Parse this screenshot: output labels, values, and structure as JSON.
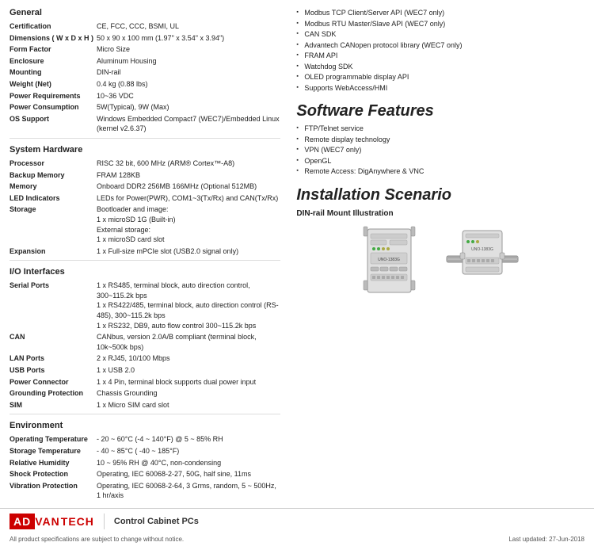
{
  "general": {
    "title": "General",
    "specs": [
      {
        "label": "Certification",
        "value": "CE, FCC, CCC, BSMI, UL"
      },
      {
        "label": "Dimensions ( W x D x H )",
        "value": "50 x 90 x 100 mm (1.97\" x 3.54\" x 3.94\")"
      },
      {
        "label": "Form Factor",
        "value": "Micro Size"
      },
      {
        "label": "Enclosure",
        "value": "Aluminum Housing"
      },
      {
        "label": "Mounting",
        "value": "DIN-rail"
      },
      {
        "label": "Weight (Net)",
        "value": "0.4 kg (0.88 lbs)"
      },
      {
        "label": "Power Requirements",
        "value": "10~36 VDC"
      },
      {
        "label": "Power Consumption",
        "value": "5W(Typical), 9W (Max)"
      },
      {
        "label": "OS Support",
        "value": "Windows Embedded Compact7 (WEC7)/Embedded Linux (kernel v2.6.37)"
      }
    ]
  },
  "system_hardware": {
    "title": "System Hardware",
    "specs": [
      {
        "label": "Processor",
        "value": "RISC 32 bit, 600 MHz (ARM® Cortex™-A8)"
      },
      {
        "label": "Backup Memory",
        "value": "FRAM 128KB"
      },
      {
        "label": "Memory",
        "value": "Onboard DDR2 256MB 166MHz (Optional 512MB)"
      },
      {
        "label": "LED Indicators",
        "value": "LEDs for Power(PWR), COM1~3(Tx/Rx) and CAN(Tx/Rx)"
      },
      {
        "label": "Storage",
        "value": "Bootloader and image:\n1 x microSD 1G (Built-in)\nExternal storage:\n1 x microSD card slot"
      },
      {
        "label": "Expansion",
        "value": "1 x Full-size mPCIe slot (USB2.0 signal only)"
      }
    ]
  },
  "io_interfaces": {
    "title": "I/O Interfaces",
    "specs": [
      {
        "label": "Serial Ports",
        "value": "1 x RS485, terminal block, auto direction control, 300~115.2k bps\n1 x RS422/485, terminal block, auto direction control (RS-485), 300~115.2k bps\n1 x RS232, DB9, auto flow control 300~115.2k bps"
      },
      {
        "label": "CAN",
        "value": "CANbus, version 2.0A/B compliant (terminal block, 10k~500k bps)"
      },
      {
        "label": "LAN Ports",
        "value": "2 x RJ45, 10/100 Mbps"
      },
      {
        "label": "USB Ports",
        "value": "1 x USB 2.0"
      },
      {
        "label": "Power Connector",
        "value": "1 x 4 Pin, terminal block supports dual power input"
      },
      {
        "label": "Grounding Protection",
        "value": "Chassis Grounding"
      },
      {
        "label": "SIM",
        "value": "1 x Micro SIM card slot"
      }
    ]
  },
  "environment": {
    "title": "Environment",
    "specs": [
      {
        "label": "Operating Temperature",
        "value": "- 20 ~ 60°C (-4 ~ 140°F) @ 5 ~ 85% RH"
      },
      {
        "label": "Storage Temperature",
        "value": "- 40 ~ 85°C ( -40 ~ 185°F)"
      },
      {
        "label": "Relative Humidity",
        "value": "10 ~ 95% RH @ 40°C, non-condensing"
      },
      {
        "label": "Shock Protection",
        "value": "Operating, IEC 60068-2-27, 50G, half sine, 11ms"
      },
      {
        "label": "Vibration Protection",
        "value": "Operating, IEC 60068-2-64, 3 Grms, random, 5 ~ 500Hz, 1 hr/axis"
      }
    ]
  },
  "right_top_bullets": [
    "Modbus TCP Client/Server API (WEC7 only)",
    "Modbus RTU Master/Slave API (WEC7 only)",
    "CAN SDK",
    "Advantech CANopen protocol library (WEC7 only)",
    "FRAM API",
    "Watchdog SDK",
    "OLED programmable display API",
    "Supports WebAccess/HMI"
  ],
  "software_features": {
    "title": "Software Features",
    "items": [
      "FTP/Telnet service",
      "Remote display technology",
      "VPN (WEC7 only)",
      "OpenGL",
      "Remote Access: DigAnywhere & VNC"
    ]
  },
  "installation_scenario": {
    "title": "Installation Scenario",
    "subtitle": "DIN-rail Mount Illustration",
    "device_label": "UNO-1383G"
  },
  "footer": {
    "logo_adv": "AD",
    "logo_van": "VAN",
    "logo_tech": "TECH",
    "brand": "ADVANTECH",
    "product_line": "Control Cabinet PCs",
    "note": "All product specifications are subject to change without notice.",
    "date": "Last updated: 27-Jun-2018"
  }
}
